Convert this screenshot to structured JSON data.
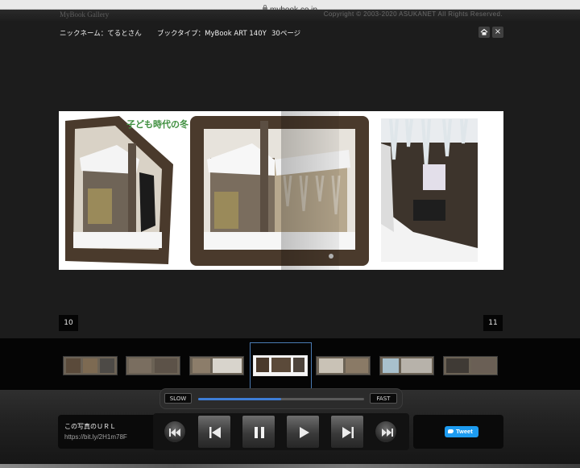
{
  "browser": {
    "url": "mybook.co.jp"
  },
  "gallery": {
    "title": "MyBook Gallery",
    "copyright": "Copyright © 2003-2020 ASUKANET All Rights Reserved."
  },
  "info": {
    "nickname": "ニックネーム：てるとさん",
    "book_type": "ブックタイプ：MyBook ART 140Y",
    "pages": "30ページ"
  },
  "toolbar": {
    "close_label": "×"
  },
  "spread": {
    "title": "子ども時代の冬"
  },
  "page_numbers": {
    "left": "10",
    "right": "11"
  },
  "speed": {
    "slow_label": "SLOW",
    "fast_label": "FAST",
    "level": 0.5
  },
  "share": {
    "url_label": "この写真のＵＲＬ",
    "url_value": "https://bit.ly/2H1m78F",
    "tweet_label": "Tweet"
  },
  "icons": {
    "home": "home-icon",
    "close": "close-icon",
    "first": "skip-first-icon",
    "prev": "previous-icon",
    "pause": "pause-icon",
    "play": "play-icon",
    "next": "next-icon",
    "last": "skip-last-icon",
    "bird": "twitter-bird-icon"
  },
  "colors": {
    "background": "#1c1c1c",
    "speed_fill": "#3e7dd6",
    "tweet_button": "#1d9bf0",
    "title_green": "#3f8f3f"
  }
}
